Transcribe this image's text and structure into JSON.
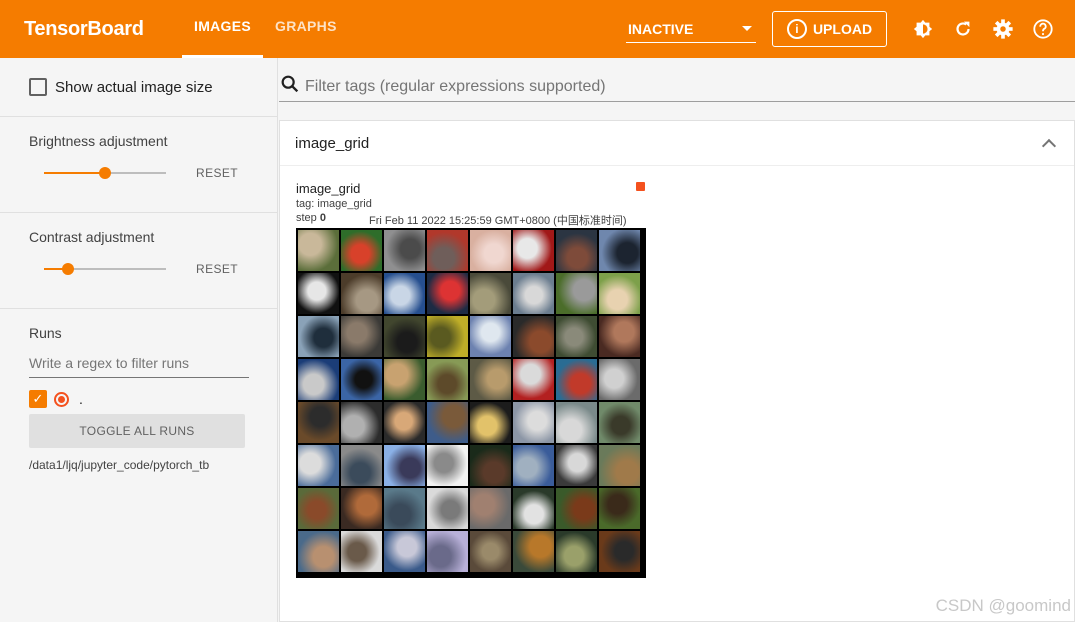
{
  "app": {
    "title": "TensorBoard"
  },
  "tabs": [
    {
      "label": "IMAGES",
      "active": true
    },
    {
      "label": "GRAPHS",
      "active": false
    }
  ],
  "status_select": {
    "value": "INACTIVE"
  },
  "upload": {
    "label": "UPLOAD",
    "icon": "upload-info-icon"
  },
  "toolbar_icons": [
    "brightness-icon",
    "refresh-icon",
    "settings-icon",
    "help-icon"
  ],
  "sidebar": {
    "show_actual_size": {
      "label": "Show actual image size",
      "checked": false
    },
    "brightness": {
      "label": "Brightness adjustment",
      "reset": "RESET",
      "level": 0.5
    },
    "contrast": {
      "label": "Contrast adjustment",
      "reset": "RESET",
      "level": 0.2
    },
    "runs": {
      "title": "Runs",
      "filter_placeholder": "Write a regex to filter runs",
      "items": [
        {
          "name": ".",
          "checked": true
        }
      ],
      "toggle_label": "TOGGLE ALL RUNS",
      "path": "/data1/ljq/jupyter_code/pytorch_tb"
    }
  },
  "main": {
    "filter_placeholder": "Filter tags (regular expressions supported)",
    "card": {
      "title": "image_grid",
      "image_title": "image_grid",
      "tag": "tag: image_grid",
      "step_label": "step",
      "step_value": "0",
      "timestamp": "Fri Feb 11 2022 15:25:59 GMT+0800 (中国标准时间)"
    }
  },
  "watermark": "CSDN @goomind",
  "colors": {
    "accent": "#f57c00",
    "run_color": "#f4511e"
  }
}
